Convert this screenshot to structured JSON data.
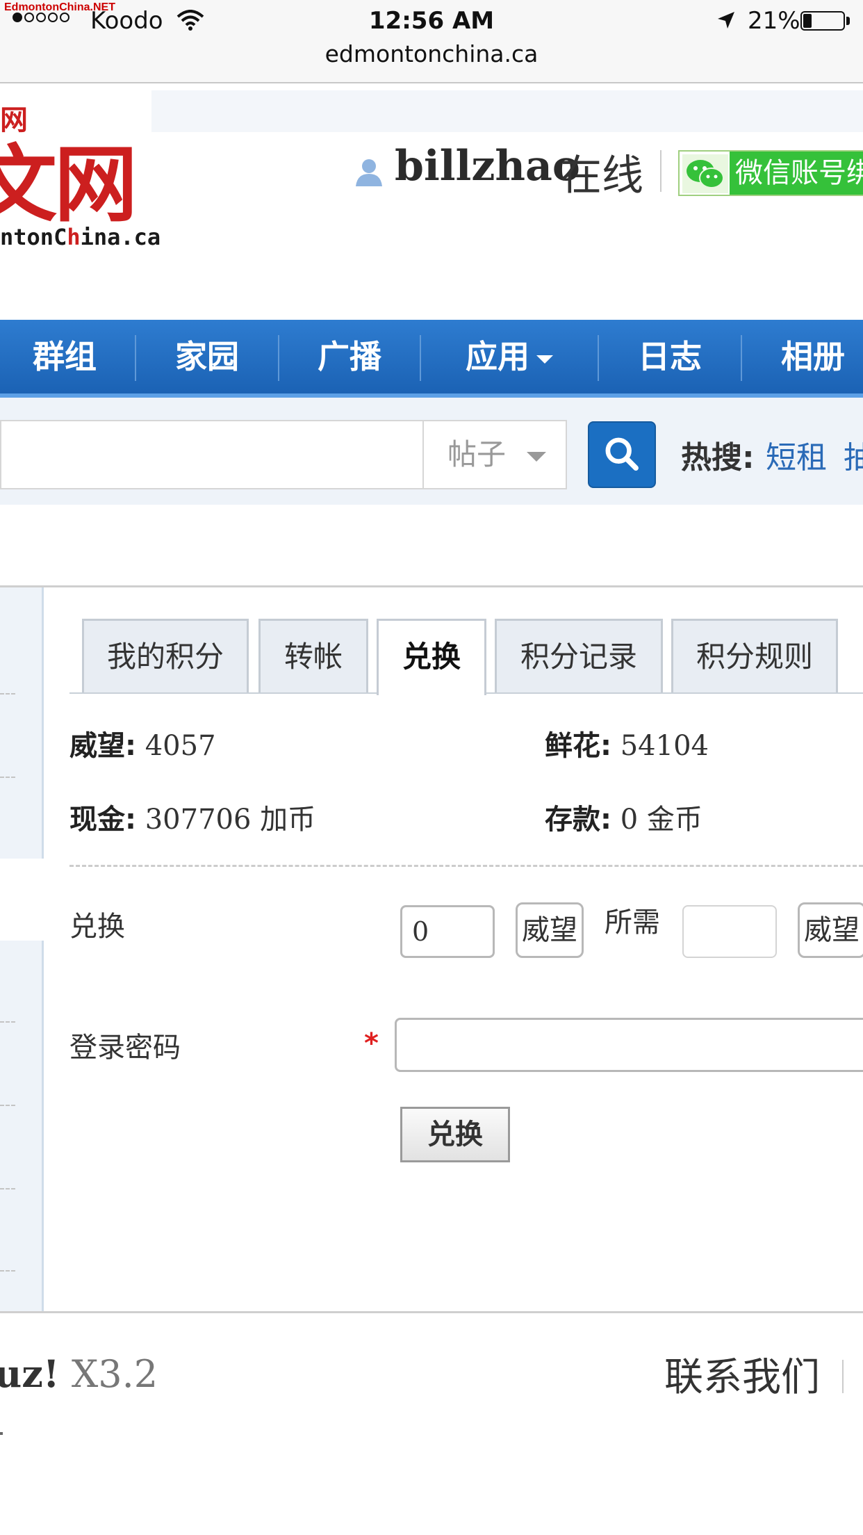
{
  "status_bar": {
    "watermark": "EdmontonChina.NET",
    "carrier": "Koodo",
    "time": "12:56 AM",
    "url": "edmontonchina.ca",
    "battery_percent": "21%",
    "battery_level": 0.21
  },
  "header": {
    "logo_glyphs": "文网",
    "logo_corner": "网",
    "logo_sub_black_1": "ntonC",
    "logo_sub_red": "h",
    "logo_sub_black_2": "ina.ca",
    "username": "billzhao",
    "online_status": "在线",
    "wechat_label": "微信账号绑"
  },
  "nav": {
    "items": [
      "群组",
      "家园",
      "广播",
      "应用",
      "日志",
      "相册"
    ]
  },
  "search": {
    "type_label": "帖子",
    "hot_label": "热搜:",
    "hot_terms": [
      "短租",
      "抽"
    ]
  },
  "tabs": [
    "我的积分",
    "转帐",
    "兑换",
    "积分记录",
    "积分规则"
  ],
  "active_tab": "兑换",
  "stats": {
    "prestige_label": "威望:",
    "prestige_value": "4057",
    "flowers_label": "鲜花:",
    "flowers_value": "54104",
    "cash_label": "现金:",
    "cash_value": "307706 加币",
    "deposit_label": "存款:",
    "deposit_value": "0 金币"
  },
  "form": {
    "exchange_label": "兑换",
    "amount_value": "0",
    "from_unit": "威望",
    "required_label": "所需",
    "to_unit": "威望",
    "password_label": "登录密码",
    "required_star": "*",
    "submit_label": "兑换"
  },
  "footer": {
    "brand_bold": "uz!",
    "brand_version": "X3.2",
    "contact": "联系我们"
  },
  "colors": {
    "nav_blue": "#1b62b4",
    "link_blue": "#2a6ab7",
    "logo_red": "#cc1f1f",
    "wechat_green": "#35c13a",
    "required_red": "#e02020"
  }
}
